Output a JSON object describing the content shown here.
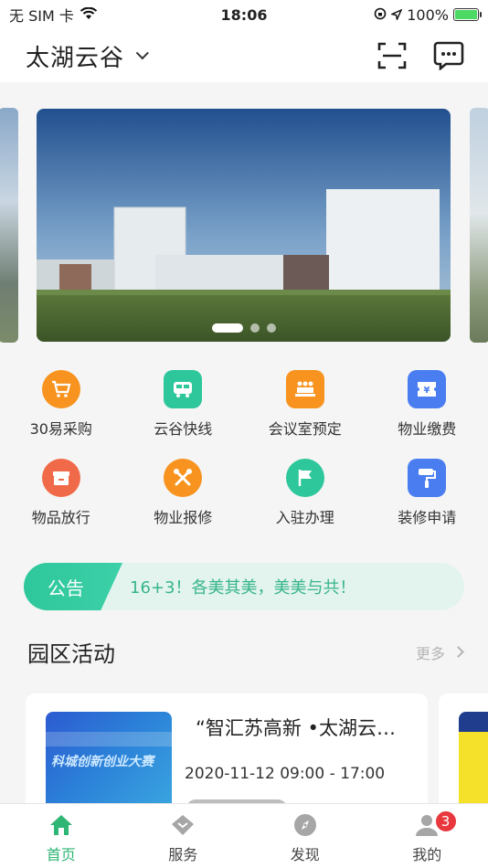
{
  "status": {
    "carrier": "无 SIM 卡",
    "time": "18:06",
    "battery": "100%"
  },
  "header": {
    "title": "太湖云谷"
  },
  "banner": {
    "page_count": 3,
    "active_page": 1
  },
  "quick_actions": [
    {
      "label": "30易采购",
      "icon": "shopping-cart-icon",
      "color": "#f7931e"
    },
    {
      "label": "云谷快线",
      "icon": "bus-icon",
      "color": "#2ec79b"
    },
    {
      "label": "会议室预定",
      "icon": "meeting-icon",
      "color": "#f7931e"
    },
    {
      "label": "物业缴费",
      "icon": "payment-icon",
      "color": "#4a7df0"
    },
    {
      "label": "物品放行",
      "icon": "box-icon",
      "color": "#f06a4a"
    },
    {
      "label": "物业报修",
      "icon": "repair-icon",
      "color": "#f7931e"
    },
    {
      "label": "入驻办理",
      "icon": "flag-icon",
      "color": "#2ec79b"
    },
    {
      "label": "装修申请",
      "icon": "paint-roller-icon",
      "color": "#4a7df0"
    }
  ],
  "notice": {
    "tag": "公告",
    "text": "16+3！各美其美，美美与共！"
  },
  "activities": {
    "title": "园区活动",
    "more": "更多",
    "card": {
      "title": "“智汇苏高新 •太湖云…",
      "date": "2020-11-12 09:00 - 17:00",
      "thumb_text": "科城创新创业大赛"
    }
  },
  "tabs": [
    {
      "label": "首页",
      "icon": "home-icon",
      "active": true
    },
    {
      "label": "服务",
      "icon": "service-icon",
      "active": false
    },
    {
      "label": "发现",
      "icon": "compass-icon",
      "active": false
    },
    {
      "label": "我的",
      "icon": "user-icon",
      "active": false,
      "badge": "3"
    }
  ],
  "colors": {
    "accent": "#2fb574",
    "notice_bg": "#e3f4ee",
    "badge": "#e8383d"
  }
}
